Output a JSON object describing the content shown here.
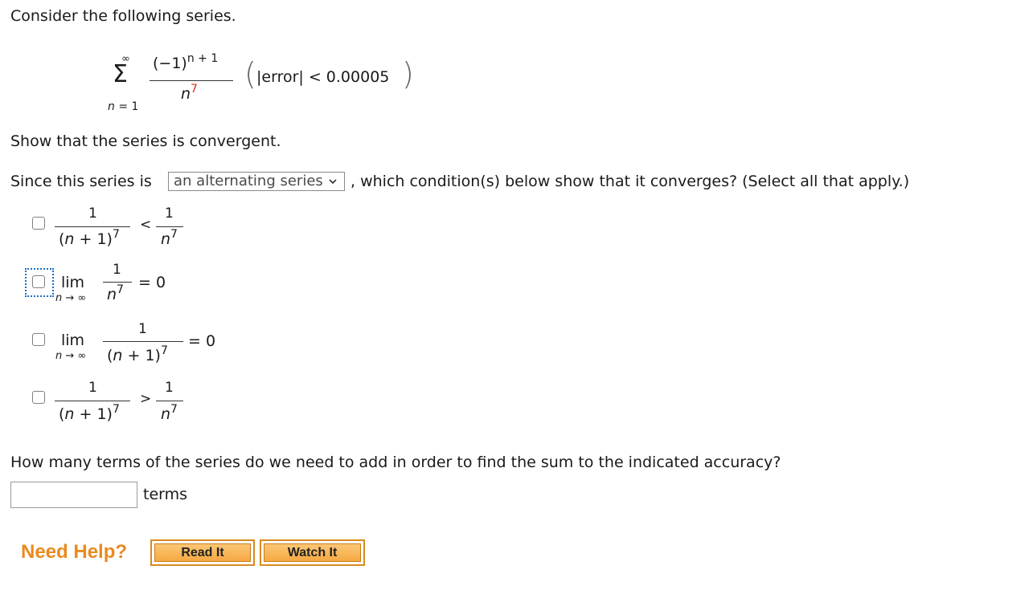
{
  "intro": "Consider the following series.",
  "series": {
    "sum_top": "∞",
    "sum_symbol": "Σ",
    "sum_bottom": "n = 1",
    "numerator": "(−1)",
    "num_exp": "n + 1",
    "denominator_base": "n",
    "denominator_exp": "7",
    "error_condition": "|error| < 0.00005"
  },
  "question1": "Show that the series is convergent.",
  "question2": {
    "prefix": "Since this series is",
    "dropdown_value": "an alternating series",
    "suffix": ", which condition(s) below show that it converges? (Select all that apply.)"
  },
  "options": [
    {
      "left_num": "1",
      "left_den": "(n + 1)",
      "left_exp": "7",
      "relation": "<",
      "right_num": "1",
      "right_den": "n",
      "right_exp": "7",
      "checked": false
    },
    {
      "lim": "lim",
      "lim_sub": "n → ∞",
      "num": "1",
      "den": "n",
      "exp": "7",
      "equals": "= 0",
      "checked": false,
      "focused": true
    },
    {
      "lim": "lim",
      "lim_sub": "n → ∞",
      "num": "1",
      "den": "(n + 1)",
      "exp": "7",
      "equals": "= 0",
      "checked": false
    },
    {
      "left_num": "1",
      "left_den": "(n + 1)",
      "left_exp": "7",
      "relation": ">",
      "right_num": "1",
      "right_den": "n",
      "right_exp": "7",
      "checked": false
    }
  ],
  "question3": "How many terms of the series do we need to add in order to find the sum to the indicated accuracy?",
  "answer": {
    "value": "",
    "unit": "terms"
  },
  "help": {
    "label": "Need Help?",
    "buttons": [
      "Read It",
      "Watch It"
    ]
  },
  "colors": {
    "help_orange": "#ea8a1e",
    "red_exponent": "#e0271b",
    "focus_blue": "#1b6fc1"
  }
}
